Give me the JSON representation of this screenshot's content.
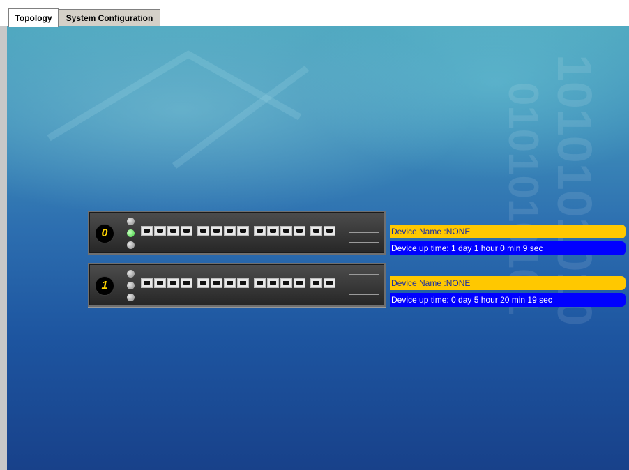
{
  "tabs": [
    {
      "label": "Topology",
      "active": true
    },
    {
      "label": "System Configuration",
      "active": false
    }
  ],
  "switches": [
    {
      "unit": "0",
      "active_led": "middle",
      "device_name": "Device Name :NONE",
      "uptime": "Device up time: 1 day 1 hour 0 min 9 sec"
    },
    {
      "unit": "1",
      "active_led": "none",
      "device_name": "Device Name :NONE",
      "uptime": "Device up time: 0 day 5 hour 20 min 19 sec"
    }
  ],
  "colors": {
    "device_name_bg": "#ffc800",
    "uptime_bg": "#0000ff",
    "led_active": "#3fd23f",
    "unit_number": "#ffd400"
  }
}
